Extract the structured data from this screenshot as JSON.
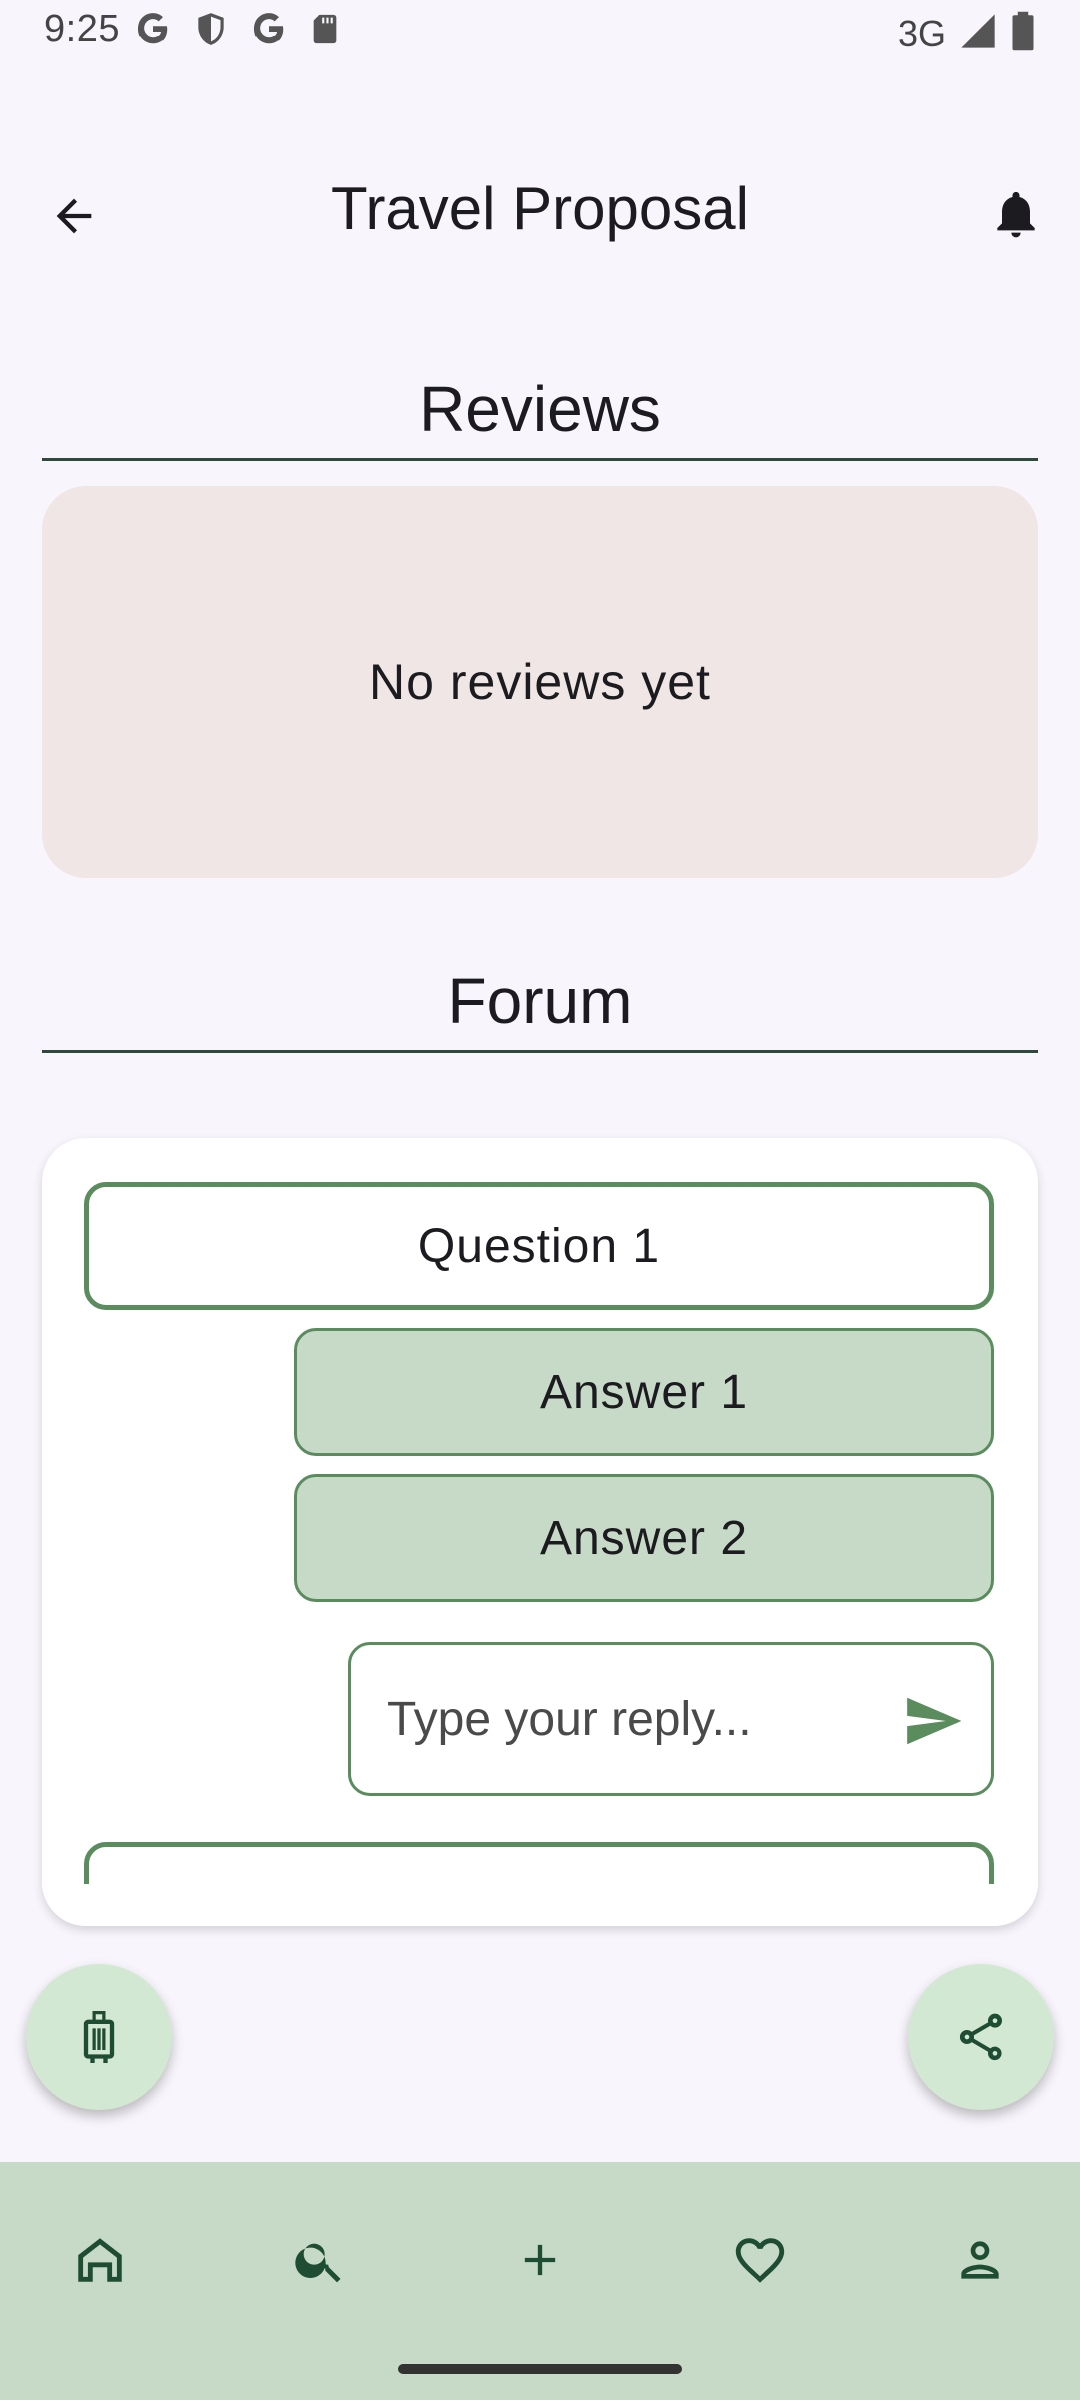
{
  "status_bar": {
    "time": "9:25",
    "network": "3G",
    "icons_left": [
      "google-icon",
      "shield-icon",
      "google-icon",
      "sd-card-icon"
    ],
    "icons_right": [
      "signal-icon",
      "battery-icon"
    ]
  },
  "app_bar": {
    "title": "Travel Proposal",
    "back_icon": "arrow-back-icon",
    "notification_icon": "bell-icon"
  },
  "reviews": {
    "title": "Reviews",
    "empty_text": "No reviews yet"
  },
  "forum": {
    "title": "Forum",
    "question": "Question 1",
    "answers": [
      "Answer 1",
      "Answer 2"
    ],
    "reply_placeholder": "Type your reply...",
    "send_icon": "send-icon"
  },
  "fabs": {
    "left_icon": "luggage-icon",
    "right_icon": "share-icon"
  },
  "bottom_nav": {
    "items": [
      "home-icon",
      "search-icon",
      "add-icon",
      "heart-icon",
      "person-icon"
    ]
  },
  "colors": {
    "accent": "#5a8c5e",
    "answer_bg": "#c7dac7",
    "nav_bg": "#c7d9c7",
    "fab_bg": "#d3e8d3",
    "review_card_bg": "#efe6e5",
    "icon_dark": "#1f4d33"
  }
}
